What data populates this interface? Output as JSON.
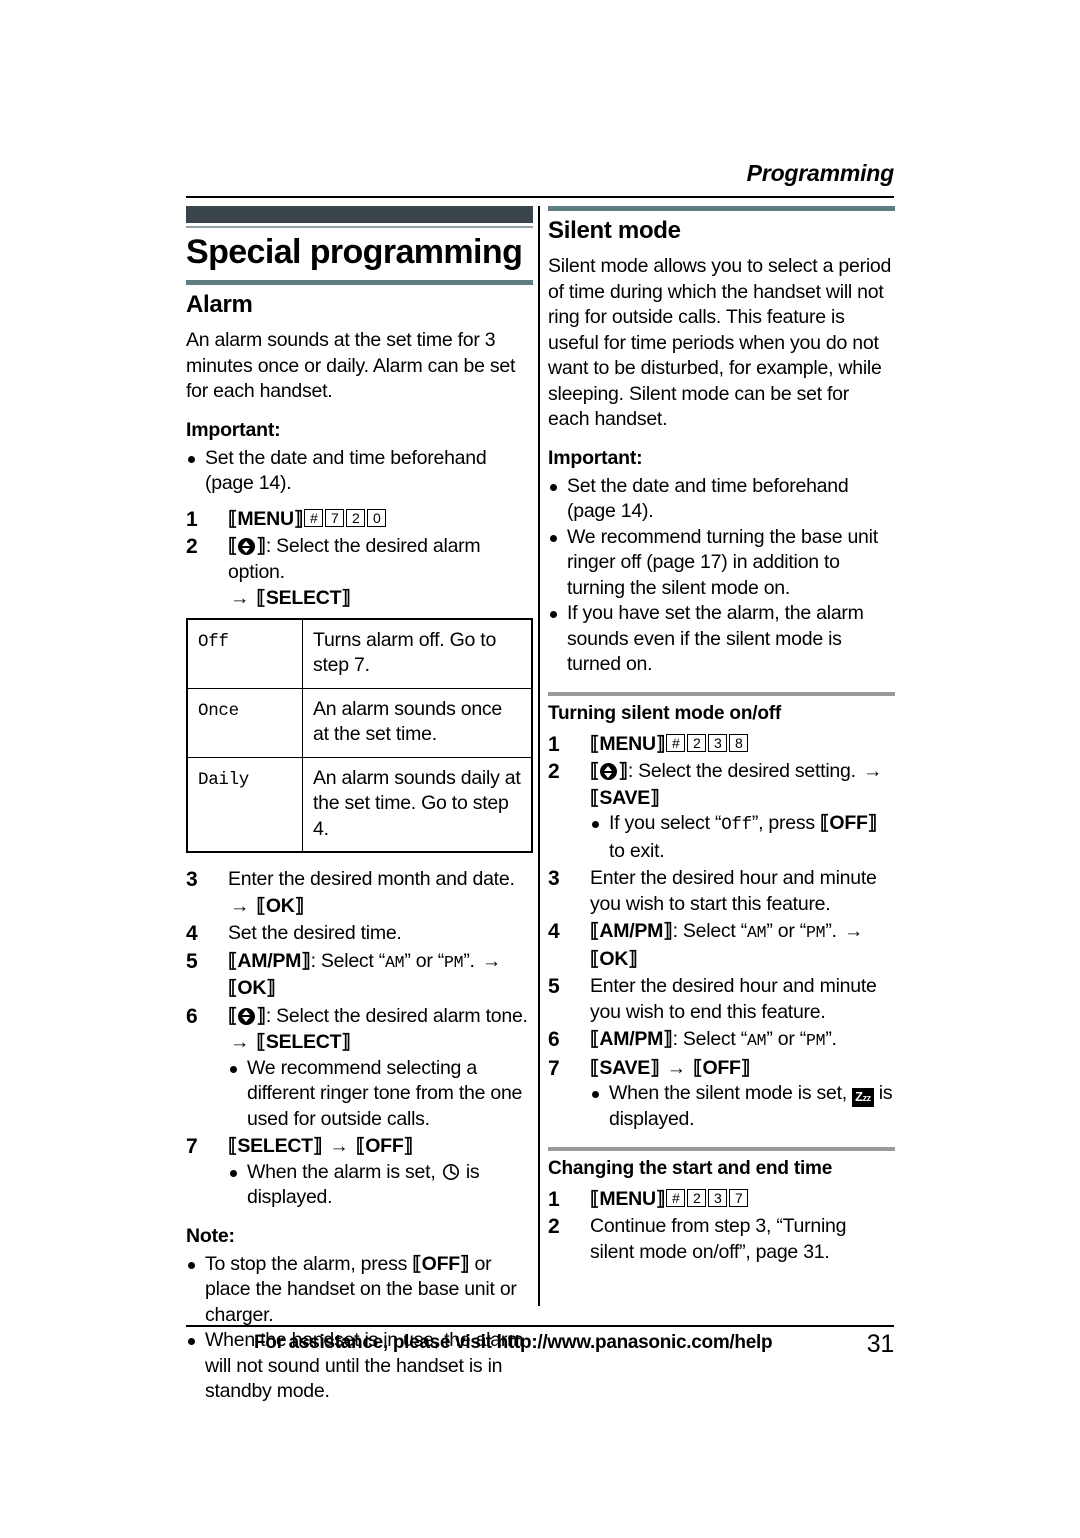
{
  "header": {
    "running_head": "Programming"
  },
  "chapter": {
    "title": "Special programming"
  },
  "left_column": {
    "section": {
      "title": "Alarm",
      "intro": "An alarm sounds at the set time for 3 minutes once or daily. Alarm can be set for each handset.",
      "important_label": "Important:",
      "important_bullets": [
        "Set the date and time beforehand (page 14)."
      ]
    },
    "steps": {
      "step1": {
        "num": "1",
        "key_menu": "MENU",
        "keys": [
          "#",
          "7",
          "2",
          "0"
        ]
      },
      "step2": {
        "num": "2",
        "text": ": Select the desired alarm option.",
        "arrow": "→",
        "key_select": "SELECT"
      },
      "step3": {
        "num": "3",
        "text": "Enter the desired month and date.",
        "arrow": "→",
        "key_ok": "OK"
      },
      "step4": {
        "num": "4",
        "text": "Set the desired time."
      },
      "step5": {
        "num": "5",
        "key_ampm": "AM/PM",
        "text": ": Select “AM” or “PM”.",
        "am": "AM",
        "pm": "PM",
        "arrow": "→",
        "key_ok": "OK"
      },
      "step6": {
        "num": "6",
        "text": ": Select the desired alarm tone.",
        "arrow": "→",
        "key_select": "SELECT",
        "bullets": [
          "We recommend selecting a different ringer tone from the one used for outside calls."
        ]
      },
      "step7": {
        "num": "7",
        "key_select": "SELECT",
        "arrow": "→",
        "key_off": "OFF",
        "bullet_pre": "When the alarm is set, ",
        "bullet_post": " is displayed.",
        "icon": "clock-icon"
      }
    },
    "option_table": {
      "rows": [
        {
          "option": "Off",
          "description": "Turns alarm off. Go to step 7."
        },
        {
          "option": "Once",
          "description": "An alarm sounds once at the set time."
        },
        {
          "option": "Daily",
          "description": "An alarm sounds daily at the set time. Go to step 4."
        }
      ]
    },
    "note": {
      "label": "Note:",
      "bullets": [
        {
          "pre": "To stop the alarm, press ",
          "key": "OFF",
          "post": " or place the handset on the base unit or charger."
        },
        {
          "pre": "When the handset is in use, the alarm will not sound until the handset is in standby mode.",
          "key": "",
          "post": ""
        }
      ]
    }
  },
  "right_column": {
    "section": {
      "title": "Silent mode",
      "intro": "Silent mode allows you to select a period of time during which the handset will not ring for outside calls. This feature is useful for time periods when you do not want to be disturbed, for example, while sleeping. Silent mode can be set for each handset.",
      "important_label": "Important:",
      "important_bullets": [
        "Set the date and time beforehand (page 14).",
        "We recommend turning the base unit ringer off (page 17) in addition to turning the silent mode on.",
        "If you have set the alarm, the alarm sounds even if the silent mode is turned on."
      ]
    },
    "subsection_on_off": {
      "title": "Turning silent mode on/off",
      "steps": {
        "step1": {
          "num": "1",
          "key_menu": "MENU",
          "keys": [
            "#",
            "2",
            "3",
            "8"
          ]
        },
        "step2": {
          "num": "2",
          "text": ": Select the desired setting.",
          "arrow": "→",
          "key_save": "SAVE",
          "bullet_pre": "If you select “",
          "bullet_off_value": "Off",
          "bullet_mid": "”, press ",
          "bullet_key": "OFF",
          "bullet_post": " to exit."
        },
        "step3": {
          "num": "3",
          "text": "Enter the desired hour and minute you wish to start this feature."
        },
        "step4": {
          "num": "4",
          "key_ampm": "AM/PM",
          "text": ": Select “AM” or “PM”.",
          "am": "AM",
          "pm": "PM",
          "arrow": "→",
          "key_ok": "OK"
        },
        "step5": {
          "num": "5",
          "text": "Enter the desired hour and minute you wish to end this feature."
        },
        "step6": {
          "num": "6",
          "key_ampm": "AM/PM",
          "text": ": Select “AM” or “PM”.",
          "am": "AM",
          "pm": "PM"
        },
        "step7": {
          "num": "7",
          "key_save": "SAVE",
          "arrow": "→",
          "key_off": "OFF",
          "bullet_pre": "When the silent mode is set, ",
          "bullet_post": " is displayed.",
          "icon": "zzz-icon",
          "icon_text": "Zzz"
        }
      }
    },
    "subsection_change_time": {
      "title": "Changing the start and end time",
      "steps": {
        "step1": {
          "num": "1",
          "key_menu": "MENU",
          "keys": [
            "#",
            "2",
            "3",
            "7"
          ]
        },
        "step2": {
          "num": "2",
          "text": "Continue from step 3, “Turning silent mode on/off”, page 31."
        }
      }
    }
  },
  "footer": {
    "text": "For assistance, please visit http://www.panasonic.com/help",
    "page_number": "31"
  },
  "colors": {
    "chapter_bar": "#3a4549",
    "section_rule": "#5f7d82",
    "subsection_rule": "#9a9a9a",
    "text": "#000000"
  }
}
